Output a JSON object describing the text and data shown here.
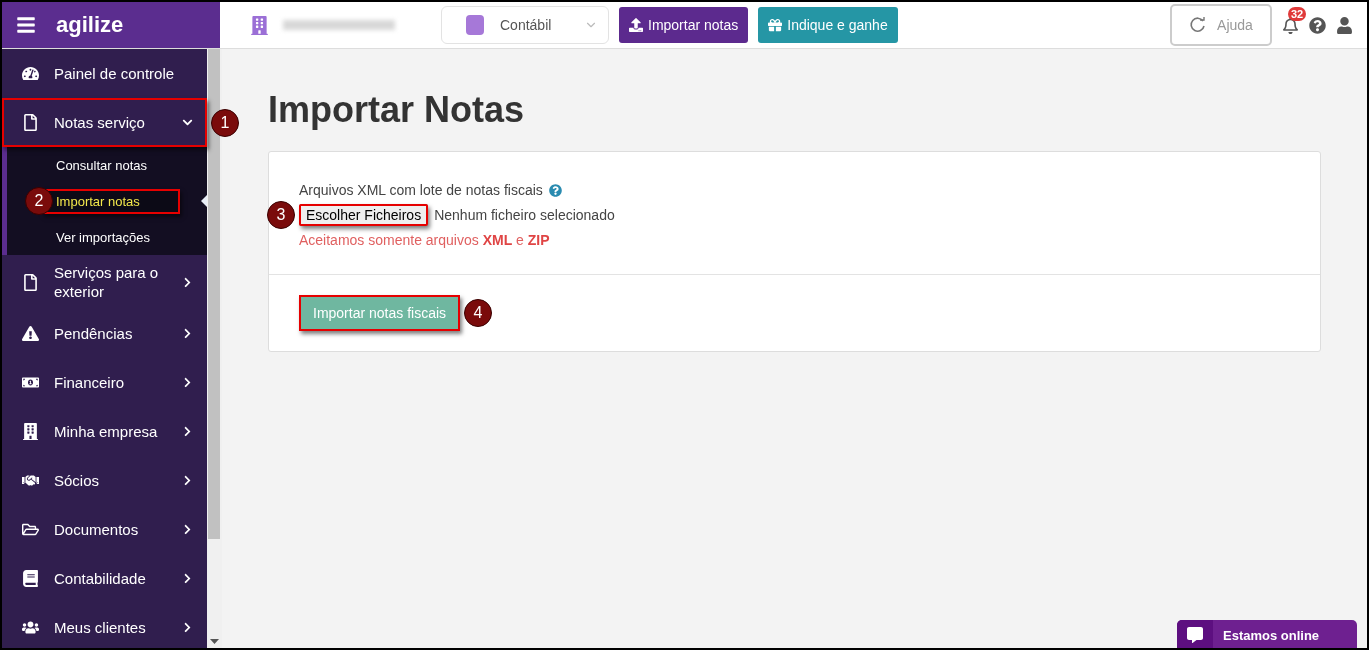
{
  "header": {
    "logo": "agilize",
    "module_select": {
      "value": "Contábil"
    },
    "buttons": [
      {
        "label": "Importar notas",
        "kind": "primary"
      },
      {
        "label": "Indique e ganhe",
        "kind": "secondary"
      }
    ],
    "help": {
      "label": "Ajuda"
    },
    "notifications": {
      "count": "32"
    }
  },
  "sidebar": {
    "items": [
      {
        "label": "Painel de controle"
      },
      {
        "label": "Notas serviço",
        "expanded": true,
        "highlighted": true,
        "callout": {
          "number": "1"
        },
        "children": [
          {
            "label": "Consultar notas",
            "selected": false,
            "highlighted": false
          },
          {
            "label": "Importar notas",
            "selected": true,
            "highlighted": true,
            "callout": {
              "number": "2"
            }
          },
          {
            "label": "Ver importações",
            "selected": false,
            "highlighted": false
          }
        ]
      },
      {
        "label": "Serviços para o exterior",
        "expanded": false,
        "highlighted": false
      },
      {
        "label": "Pendências",
        "expanded": false,
        "highlighted": false
      },
      {
        "label": "Financeiro",
        "expanded": false,
        "highlighted": false
      },
      {
        "label": "Minha empresa",
        "expanded": false,
        "highlighted": false
      },
      {
        "label": "Sócios",
        "expanded": false,
        "highlighted": false
      },
      {
        "label": "Documentos",
        "expanded": false,
        "highlighted": false
      },
      {
        "label": "Contabilidade",
        "expanded": false,
        "highlighted": false
      },
      {
        "label": "Meus clientes",
        "expanded": false,
        "highlighted": false
      }
    ]
  },
  "page": {
    "title": "Importar Notas",
    "upload": {
      "label": "Arquivos XML com lote de notas fiscais",
      "choose_button": {
        "label": "Escolher Ficheiros",
        "highlighted": true,
        "callout": {
          "number": "3"
        }
      },
      "file_status": "Nenhum ficheiro selecionado",
      "note": "Aceitamos somente arquivos **XML** e **ZIP**"
    },
    "submit_button": {
      "label": "Importar notas fiscais",
      "highlighted": true,
      "callout": {
        "number": "4"
      }
    }
  },
  "chat": {
    "label": "Estamos online"
  }
}
